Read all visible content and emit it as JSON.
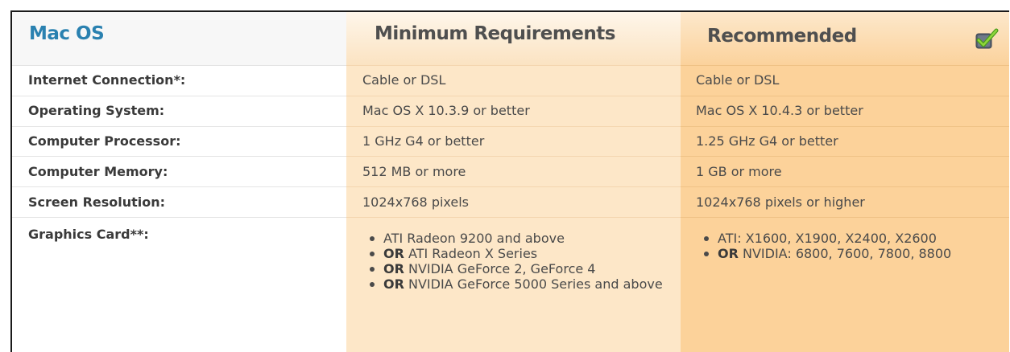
{
  "table": {
    "platform_title": "Mac OS",
    "min_header": "Minimum Requirements",
    "rec_header": "Recommended",
    "rec_icon": "checkmark-icon",
    "rows": [
      {
        "label": "Internet Connection*:",
        "minimum": "Cable or DSL",
        "recommended": "Cable or DSL"
      },
      {
        "label": "Operating System:",
        "minimum": "Mac OS X 10.3.9 or better",
        "recommended": "Mac OS X 10.4.3 or better"
      },
      {
        "label": "Computer Processor:",
        "minimum": "1 GHz G4 or better",
        "recommended": "1.25 GHz G4 or better"
      },
      {
        "label": "Computer Memory:",
        "minimum": "512 MB or more",
        "recommended": "1 GB or more"
      },
      {
        "label": "Screen Resolution:",
        "minimum": "1024x768 pixels",
        "recommended": "1024x768 pixels or higher"
      }
    ],
    "graphics": {
      "label": "Graphics Card**:",
      "minimum": [
        {
          "prefix": "",
          "text": "ATI Radeon 9200 and above"
        },
        {
          "prefix": "OR",
          "text": " ATI Radeon X Series"
        },
        {
          "prefix": "OR",
          "text": " NVIDIA GeForce 2, GeForce 4"
        },
        {
          "prefix": "OR",
          "text": " NVIDIA GeForce 5000 Series and above"
        }
      ],
      "recommended": [
        {
          "prefix": "",
          "text": "ATI: X1600, X1900, X2400, X2600"
        },
        {
          "prefix": "OR",
          "text": " NVIDIA: 6800, 7600, 7800, 8800"
        }
      ]
    },
    "colors": {
      "title_blue": "#2a81b0",
      "min_column": "#fde7c8",
      "rec_column": "#fcd29a",
      "check_green": "#6fbf2a"
    }
  }
}
